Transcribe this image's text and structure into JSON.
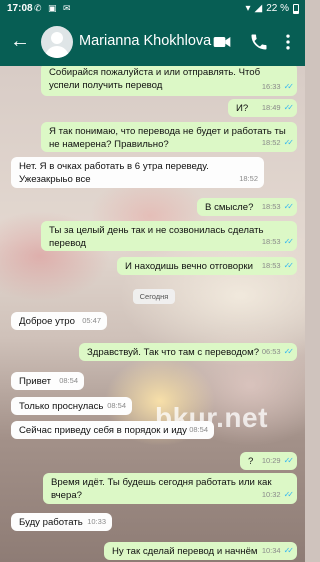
{
  "status_bar": {
    "time": "17:08",
    "battery": "22 %"
  },
  "header": {
    "contact_name": "Marianna Khokhlova"
  },
  "date_chip": "Сегодня",
  "watermark": "bkur.net",
  "messages": [
    {
      "dir": "out",
      "text": "Собирайся пожалуйста и или отправлять. Чтоб успели получить перевод",
      "time": "16:33",
      "read": true
    },
    {
      "dir": "out",
      "text": "И?",
      "time": "18:49",
      "read": true
    },
    {
      "dir": "out",
      "text": "Я так понимаю, что перевода не будет и работать ты не намерена? Правильно?",
      "time": "18:52",
      "read": true
    },
    {
      "dir": "in",
      "text": "Нет. Я в очках работать в 6 утра переведу. Ужезакрыьо все",
      "time": "18:52"
    },
    {
      "dir": "out",
      "text": "В смысле?",
      "time": "18:53",
      "read": true
    },
    {
      "dir": "out",
      "text": "Ты за целый день так и не созвонилась сделать перевод",
      "time": "18:53",
      "read": true
    },
    {
      "dir": "out",
      "text": "И находишь вечно отговорки",
      "time": "18:53",
      "read": true
    },
    {
      "dir": "in",
      "text": "Доброе утро",
      "time": "05:47"
    },
    {
      "dir": "out",
      "text": "Здравствуй. Так что там с переводом?",
      "time": "06:53",
      "read": true
    },
    {
      "dir": "in",
      "text": "Привет",
      "time": "08:54"
    },
    {
      "dir": "in",
      "text": "Только проснулась",
      "time": "08:54"
    },
    {
      "dir": "in",
      "text": "Сейчас приведу себя в порядок и иду",
      "time": "08:54"
    },
    {
      "dir": "out",
      "text": "?",
      "time": "10:29",
      "read": true
    },
    {
      "dir": "out",
      "text": "Время идёт. Ты будешь сегодня работать или как вчера?",
      "time": "10:32",
      "read": true
    },
    {
      "dir": "in",
      "text": "Буду работать",
      "time": "10:33"
    },
    {
      "dir": "out",
      "text": "Ну так сделай перевод и начнём",
      "time": "10:34",
      "read": true
    }
  ]
}
